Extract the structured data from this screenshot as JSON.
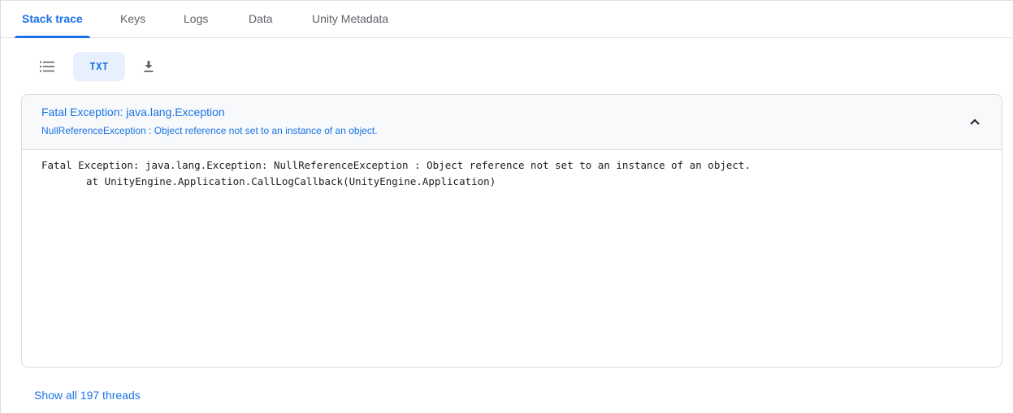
{
  "tabs": [
    {
      "label": "Stack trace",
      "active": true
    },
    {
      "label": "Keys",
      "active": false
    },
    {
      "label": "Logs",
      "active": false
    },
    {
      "label": "Data",
      "active": false
    },
    {
      "label": "Unity Metadata",
      "active": false
    }
  ],
  "toolbar": {
    "list_icon": "list-icon",
    "txt_label": "TXT",
    "download_icon": "download-icon"
  },
  "exception": {
    "title": "Fatal Exception: java.lang.Exception",
    "subtitle": "NullReferenceException : Object reference not set to an instance of an object.",
    "collapse_icon": "chevron-up-icon",
    "stack_lines": [
      "Fatal Exception: java.lang.Exception: NullReferenceException : Object reference not set to an instance of an object.",
      "at UnityEngine.Application.CallLogCallback(UnityEngine.Application)"
    ]
  },
  "footer": {
    "show_threads_label": "Show all 197 threads"
  },
  "colors": {
    "accent": "#1a73e8",
    "active_button_bg": "#e8f0fe",
    "header_bg": "#f8f9fa",
    "border": "#dadce0"
  }
}
